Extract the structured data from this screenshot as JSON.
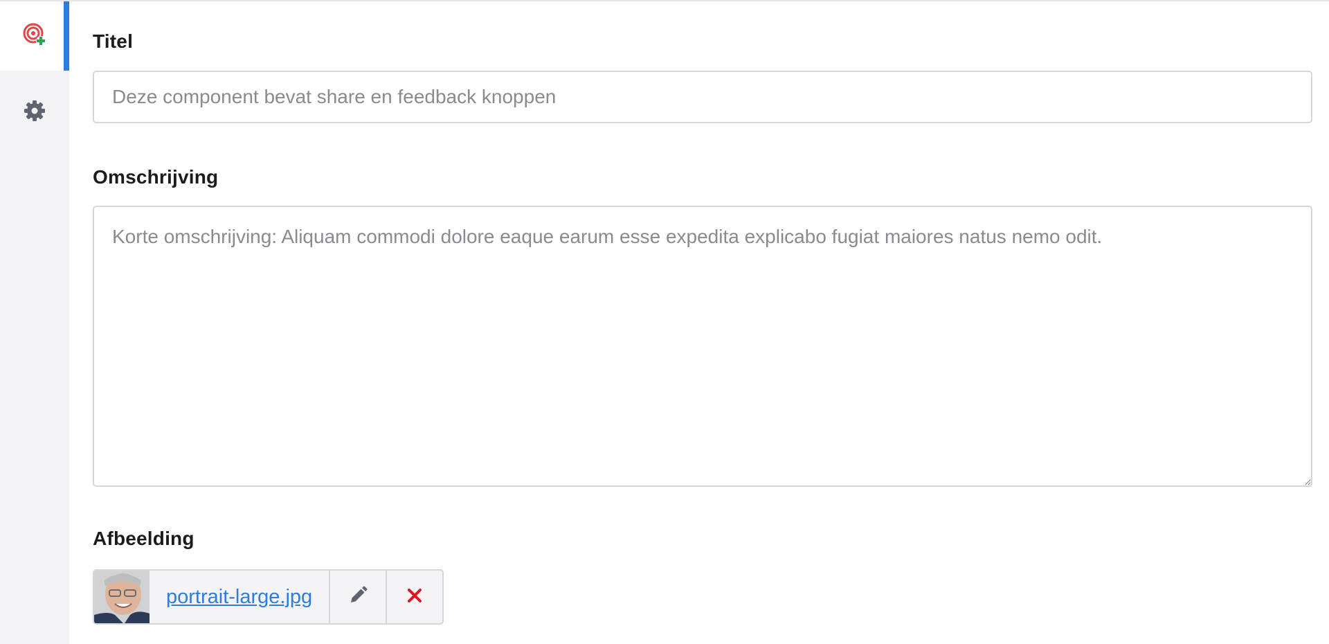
{
  "sidebar": {
    "tabs": [
      {
        "icon": "target-add-icon",
        "active": true
      },
      {
        "icon": "gear-icon",
        "active": false
      }
    ]
  },
  "form": {
    "title": {
      "label": "Titel",
      "placeholder": "Deze component bevat share en feedback knoppen",
      "value": ""
    },
    "description": {
      "label": "Omschrijving",
      "placeholder": "Korte omschrijving: Aliquam commodi dolore eaque earum esse expedita explicabo fugiat maiores natus nemo odit.",
      "value": ""
    },
    "image": {
      "label": "Afbeelding",
      "filename": "portrait-large.jpg",
      "edit_icon": "pencil-icon",
      "remove_icon": "close-icon"
    }
  },
  "colors": {
    "accent": "#2b7de0",
    "danger": "#e0131f",
    "sidebar_bg": "#f3f3f6",
    "icon_gray": "#5f6470"
  }
}
